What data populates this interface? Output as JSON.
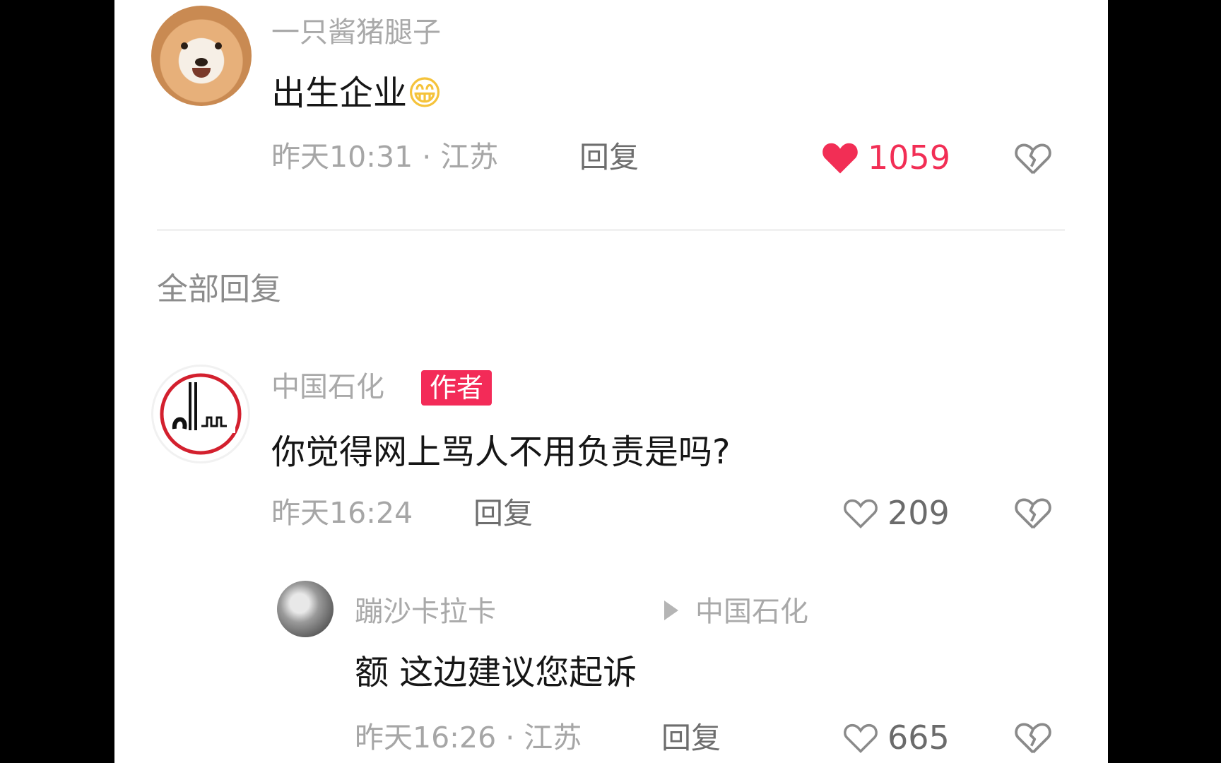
{
  "top_comment": {
    "username": "一只酱猪腿子",
    "text": "出生企业",
    "emoji": "😁",
    "time": "昨天10:31 · 江苏",
    "reply_label": "回复",
    "likes": "1059"
  },
  "section_title": "全部回复",
  "replies": [
    {
      "username": "中国石化",
      "badge": "作者",
      "text": "你觉得网上骂人不用负责是吗?",
      "time": "昨天16:24",
      "reply_label": "回复",
      "likes": "209"
    },
    {
      "username": "蹦沙卡拉卡",
      "target": "中国石化",
      "text": "额 这边建议您起诉",
      "time": "昨天16:26 · 江苏",
      "reply_label": "回复",
      "likes": "665"
    }
  ],
  "colors": {
    "liked": "#f22e55",
    "badge": "#f32b58"
  }
}
